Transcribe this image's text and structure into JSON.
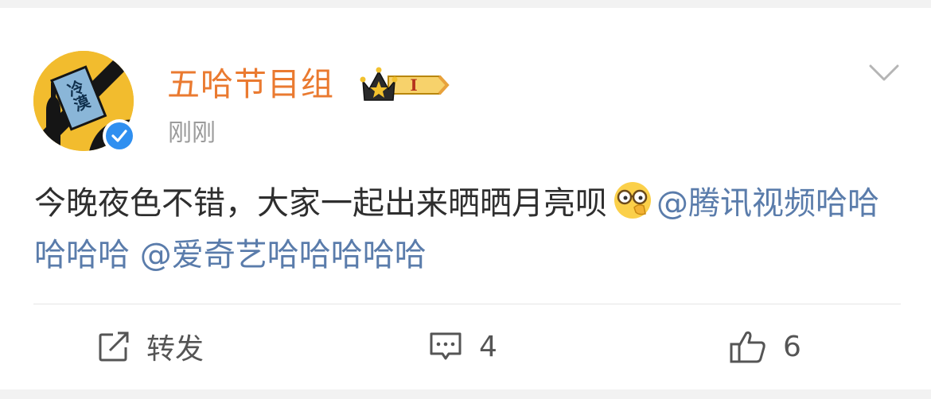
{
  "post": {
    "author": "五哈节目组",
    "avatar_text": "冷漠",
    "level_badge": "I",
    "timestamp": "刚刚",
    "text_main": "今晚夜色不错，大家一起出来晒晒月亮呗",
    "emoji": "glasses-face-emoji",
    "mention_1": "@腾讯视频哈哈哈哈哈",
    "mention_2": "@爱奇艺哈哈哈哈哈"
  },
  "actions": {
    "repost_label": "转发",
    "comment_count": "4",
    "like_count": "6"
  },
  "colors": {
    "username": "#ea7a30",
    "mention": "#5a7cab",
    "verified": "#2f8ff0",
    "avatar_bg": "#f2bc2e"
  }
}
